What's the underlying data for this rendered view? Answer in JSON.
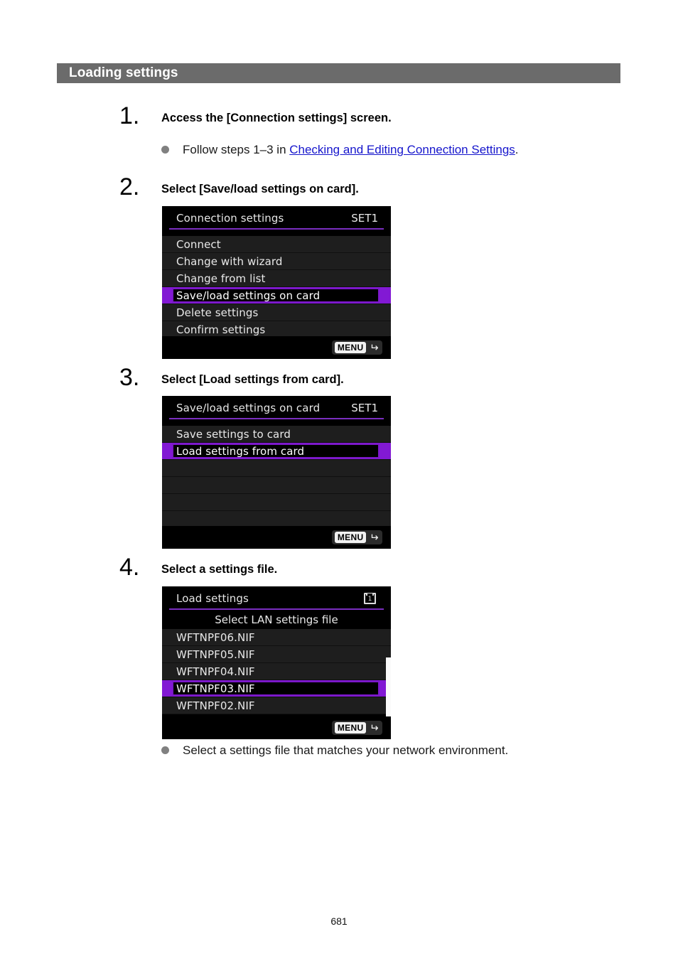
{
  "section": {
    "title": "Loading settings"
  },
  "steps": [
    {
      "number": "1.",
      "title": "Access the [Connection settings] screen.",
      "bullet_prefix": "Follow steps 1–3 in ",
      "bullet_link": "Checking and Editing Connection Settings",
      "bullet_suffix": "."
    },
    {
      "number": "2.",
      "title": "Select [Save/load settings on card]."
    },
    {
      "number": "3.",
      "title": "Select [Load settings from card]."
    },
    {
      "number": "4.",
      "title": "Select a settings file.",
      "bullet": "Select a settings file that matches your network environment."
    }
  ],
  "screens": {
    "connection_settings": {
      "header_title": "Connection settings",
      "header_right": "SET1",
      "menu_button": "MENU",
      "items": [
        {
          "label": "Connect",
          "selected": false
        },
        {
          "label": "Change with wizard",
          "selected": false
        },
        {
          "label": "Change from list",
          "selected": false
        },
        {
          "label": "Save/load settings on card",
          "selected": true
        },
        {
          "label": "Delete settings",
          "selected": false
        },
        {
          "label": "Confirm settings",
          "selected": false
        }
      ]
    },
    "save_load_settings": {
      "header_title": "Save/load settings on card",
      "header_right": "SET1",
      "menu_button": "MENU",
      "items": [
        {
          "label": "Save settings to card",
          "selected": false
        },
        {
          "label": "Load settings from card",
          "selected": true
        },
        {
          "label": "",
          "selected": false
        },
        {
          "label": "",
          "selected": false
        },
        {
          "label": "",
          "selected": false
        },
        {
          "label": "",
          "selected": false
        }
      ]
    },
    "load_settings": {
      "header_title": "Load settings",
      "header_icon": "card-slot-1-icon",
      "header_icon_number": "1",
      "subheader": "Select LAN settings file",
      "menu_button": "MENU",
      "items": [
        {
          "label": "WFTNPF06.NIF",
          "selected": false
        },
        {
          "label": "WFTNPF05.NIF",
          "selected": false
        },
        {
          "label": "WFTNPF04.NIF",
          "selected": false
        },
        {
          "label": "WFTNPF03.NIF",
          "selected": true
        },
        {
          "label": "WFTNPF02.NIF",
          "selected": false
        }
      ]
    }
  },
  "footer": {
    "page_number": "681"
  },
  "colors": {
    "header_bar": "#6b6b6b",
    "accent_purple": "#8219d4",
    "link_blue": "#1515cc",
    "bullet_gray": "#808080"
  }
}
